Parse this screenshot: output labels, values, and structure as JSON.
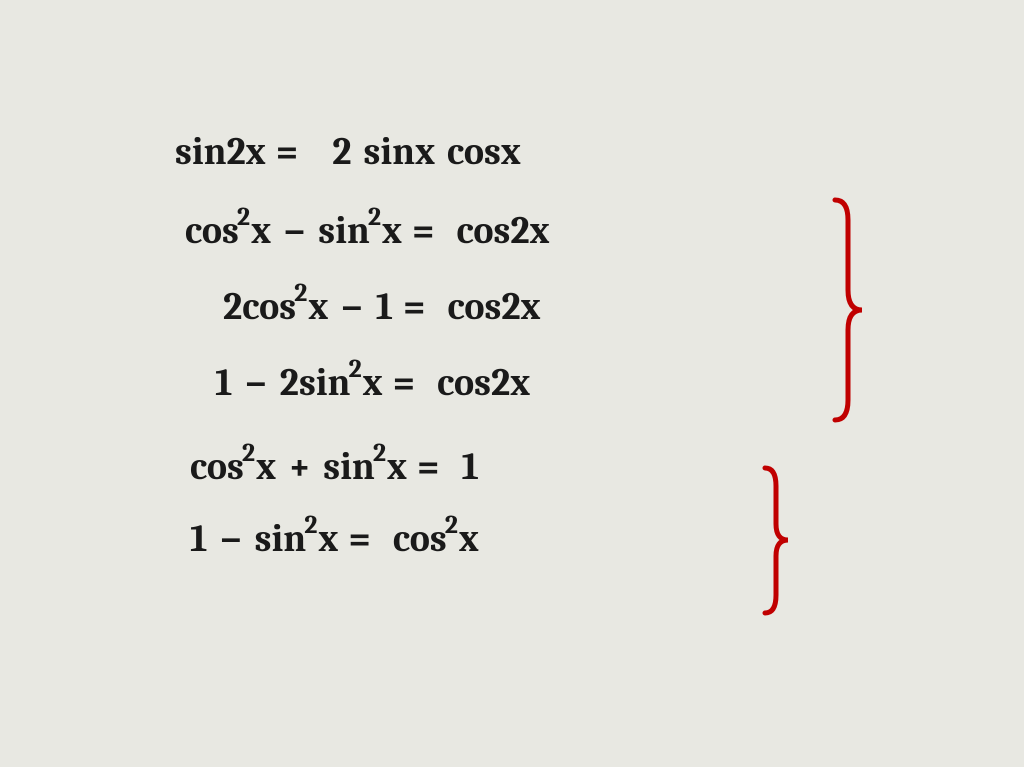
{
  "equations": {
    "line1": {
      "lhs_func": "sin",
      "lhs_arg": "2x",
      "rhs_coef": "2",
      "rhs_func1": "sin",
      "rhs_arg1": "x",
      "rhs_func2": "cos",
      "rhs_arg2": "x"
    },
    "line2": {
      "t1_func": "cos",
      "t1_exp": "2",
      "t1_arg": "x",
      "op": "−",
      "t2_func": "sin",
      "t2_exp": "2",
      "t2_arg": "x",
      "rhs_func": "cos",
      "rhs_arg": "2x"
    },
    "line3": {
      "t1_coef": "2",
      "t1_func": "cos",
      "t1_exp": "2",
      "t1_arg": "x",
      "op": "−",
      "t2": "1",
      "rhs_func": "cos",
      "rhs_arg": "2x"
    },
    "line4": {
      "t1": "1",
      "op": "−",
      "t2_coef": "2",
      "t2_func": "sin",
      "t2_exp": "2",
      "t2_arg": "x",
      "rhs_func": "cos",
      "rhs_arg": "2x"
    },
    "line5": {
      "t1_func": "cos",
      "t1_exp": "2",
      "t1_arg": "x",
      "op": "+",
      "t2_func": "sin",
      "t2_exp": "2",
      "t2_arg": "x",
      "rhs": "1"
    },
    "line6": {
      "t1": "1",
      "op": "−",
      "t2_func": "sin",
      "t2_exp": "2",
      "t2_arg": "x",
      "rhs_func": "cos",
      "rhs_exp": "2",
      "rhs_arg": "x"
    }
  },
  "brace_color_1": "#c00000",
  "brace_color_2": "#c00000"
}
